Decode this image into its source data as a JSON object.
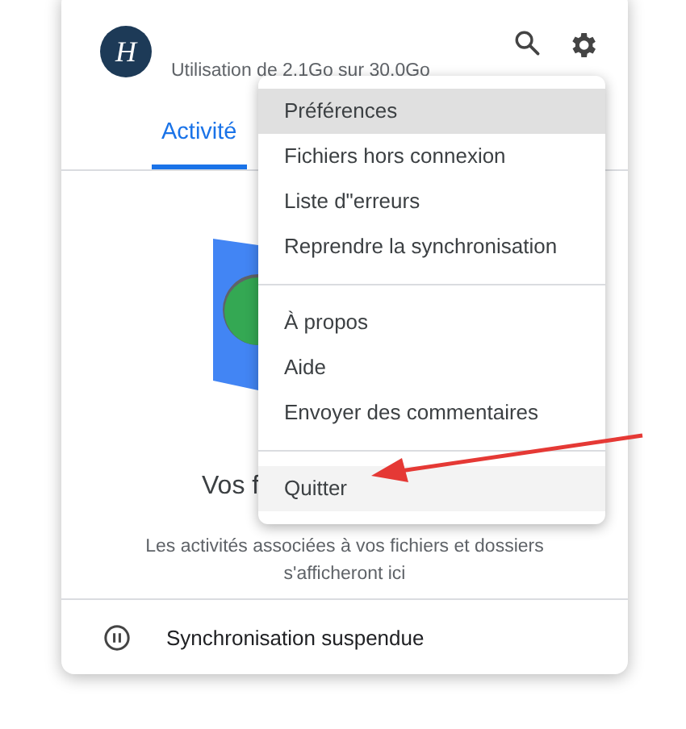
{
  "header": {
    "avatar_letter": "H",
    "usage": "Utilisation de 2.1Go sur 30.0Go"
  },
  "tabs": [
    {
      "label": "Activité",
      "selected": true
    }
  ],
  "empty_state": {
    "heading": "Vos f",
    "description": "Les activités associées à vos fichiers et dossiers s'afficheront ici"
  },
  "footer": {
    "status": "Synchronisation suspendue"
  },
  "menu": {
    "groups": [
      [
        {
          "label": "Préférences",
          "selected": true,
          "hovered": false
        },
        {
          "label": "Fichiers hors connexion",
          "selected": false,
          "hovered": false
        },
        {
          "label": "Liste d\"erreurs",
          "selected": false,
          "hovered": false
        },
        {
          "label": "Reprendre la synchronisation",
          "selected": false,
          "hovered": false
        }
      ],
      [
        {
          "label": "À propos",
          "selected": false,
          "hovered": false
        },
        {
          "label": "Aide",
          "selected": false,
          "hovered": false
        },
        {
          "label": "Envoyer des commentaires",
          "selected": false,
          "hovered": false
        }
      ],
      [
        {
          "label": "Quitter",
          "selected": false,
          "hovered": true
        }
      ]
    ]
  }
}
